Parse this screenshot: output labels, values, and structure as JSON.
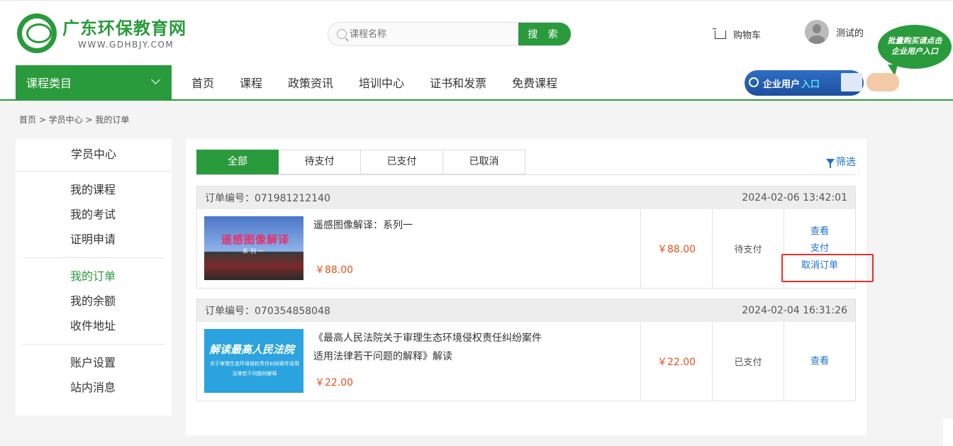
{
  "header": {
    "logo_cn": "广东环保教育网",
    "logo_en": "WWW.GDHBJY.COM",
    "search_placeholder": "课程名称",
    "search_button": "搜 索",
    "cart_label": "购物车",
    "user_name": "测试的",
    "bubble_line1": "批量购买请点击",
    "bubble_line2": "企业用户入口",
    "enterprise_label": "企业用户",
    "enterprise_highlight": "入口"
  },
  "nav": {
    "category_label": "课程类目",
    "links": [
      "首页",
      "课程",
      "政策资讯",
      "培训中心",
      "证书和发票",
      "免费课程"
    ]
  },
  "breadcrumb": "首页 > 学员中心 > 我的订单",
  "sidebar": {
    "title": "学员中心",
    "group1": [
      "我的课程",
      "我的考试",
      "证明申请"
    ],
    "group2": [
      "我的订单",
      "我的余额",
      "收件地址"
    ],
    "group3": [
      "账户设置",
      "站内消息"
    ],
    "active": "我的订单"
  },
  "tabs": [
    "全部",
    "待支付",
    "已支付",
    "已取消"
  ],
  "filter_label": "筛选",
  "orders": [
    {
      "order_label": "订单编号：071981212140",
      "datetime": "2024-02-06 13:42:01",
      "thumb_title": "遥感图像解译",
      "thumb_sub": "系列一",
      "name": "遥感图像解译：系列一",
      "price": "￥88.00",
      "total": "￥88.00",
      "status": "待支付",
      "ops": [
        "查看",
        "支付",
        "取消订单"
      ]
    },
    {
      "order_label": "订单编号：070354858048",
      "datetime": "2024-02-04 16:31:26",
      "thumb_title": "解读最高人民法院",
      "thumb_sub": "关于审理生态环境侵权责任纠纷案件适用法律若干问题的解释",
      "name": "《最高人民法院关于审理生态环境侵权责任纠纷案件适用法律若干问题的解释》解读",
      "price": "￥22.00",
      "total": "￥22.00",
      "status": "已支付",
      "ops": [
        "查看"
      ]
    }
  ],
  "colors": {
    "brand_green": "#2a9b3c",
    "price_orange": "#e8501c",
    "link_blue": "#1e6fd0",
    "highlight_red": "#e63030"
  }
}
